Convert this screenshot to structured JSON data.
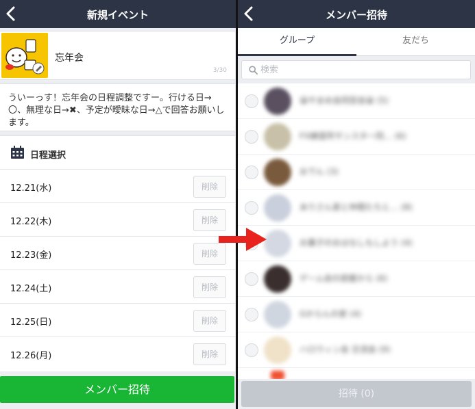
{
  "left": {
    "nav_title": "新規イベント",
    "event": {
      "title": "忘年会",
      "counter": "3/30"
    },
    "description": "ういーっす！忘年会の日程調整ですー。行ける日→〇、無理な日→✖、予定が曖昧な日→△で回答お願いします。",
    "schedule": {
      "title": "日程選択",
      "dates": [
        {
          "label": "12.21(水)",
          "delete": "削除"
        },
        {
          "label": "12.22(木)",
          "delete": "削除"
        },
        {
          "label": "12.23(金)",
          "delete": "削除"
        },
        {
          "label": "12.24(土)",
          "delete": "削除"
        },
        {
          "label": "12.25(日)",
          "delete": "削除"
        },
        {
          "label": "12.26(月)",
          "delete": "削除"
        }
      ]
    },
    "primary_button": "メンバー招待"
  },
  "right": {
    "nav_title": "メンバー招待",
    "tabs": [
      {
        "label": "グループ",
        "active": true
      },
      {
        "label": "友だち",
        "active": false
      }
    ],
    "search": {
      "placeholder": "検索",
      "value": ""
    },
    "members": [
      {
        "name": "😀やまめ会同窓会😀 (5)",
        "avatar_color": "#5a5060"
      },
      {
        "name": "FX練習所サンスター同… (6)",
        "avatar_color": "#c8c0a8"
      },
      {
        "name": "おでん (3)",
        "avatar_color": "#7a5a3c"
      },
      {
        "name": "ありさん家と仲間たちと… (8)",
        "avatar_color": "#c9cfdc"
      },
      {
        "name": "お菓子のおはなしもしよう (4)",
        "avatar_color": "#d3d8e2"
      },
      {
        "name": "ゲーム会の部屋から (6)",
        "avatar_color": "#3a2e2e"
      },
      {
        "name": "Gからんの家 (4)",
        "avatar_color": "#d0d6e0"
      },
      {
        "name": "ハロウィン会 交流会 (9)",
        "avatar_color": "#efe2c8"
      }
    ],
    "invite_button": "招待 (0)"
  },
  "colors": {
    "navbar": "#2d3446",
    "primary_green": "#19b636",
    "arrow_red": "#e8231d",
    "background": "#eceef2"
  }
}
